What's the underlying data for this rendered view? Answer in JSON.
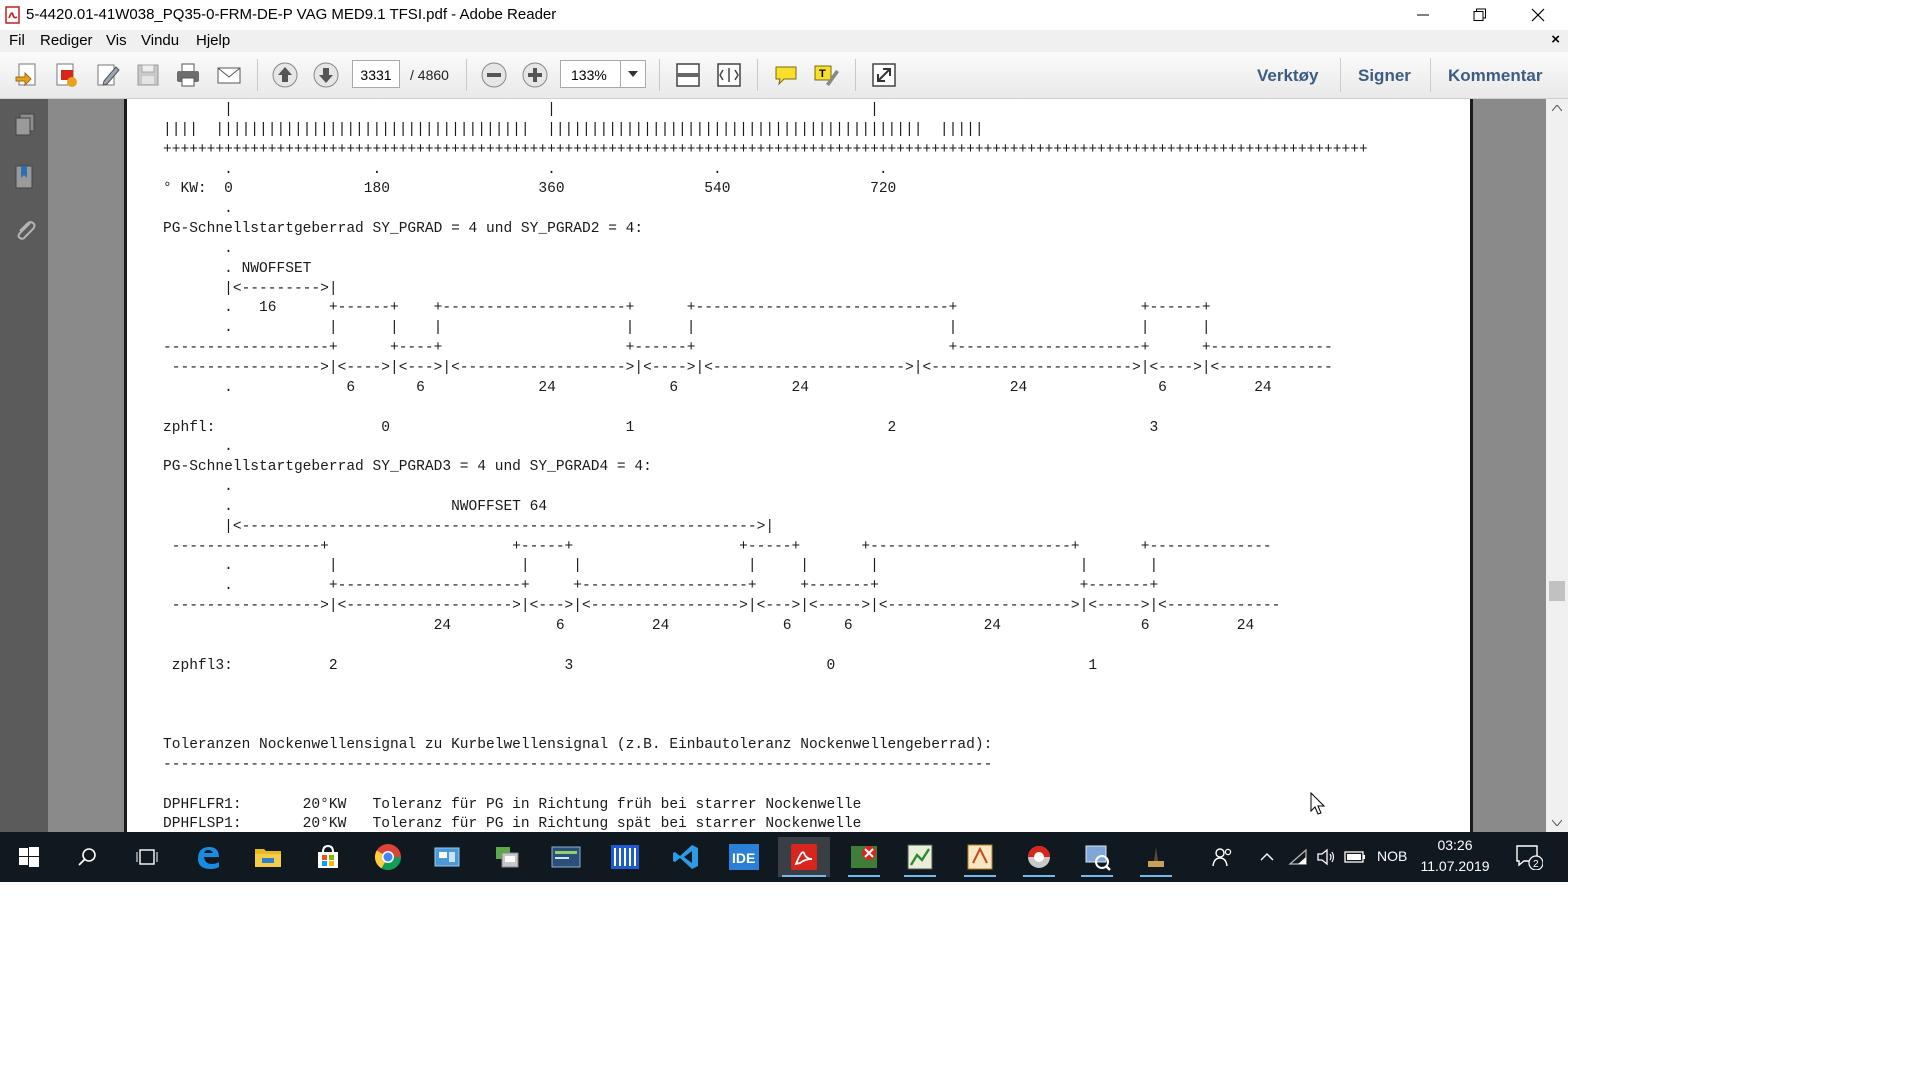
{
  "window": {
    "title": "5-4420.01-41W038_PQ35-0-FRM-DE-P VAG MED9.1 TFSI.pdf - Adobe Reader",
    "doc_close": "×"
  },
  "menu": {
    "file": "Fil",
    "edit": "Rediger",
    "view": "Vis",
    "window": "Vindu",
    "help": "Hjelp"
  },
  "toolbar": {
    "page_current": "3331",
    "page_total": "/ 4860",
    "zoom": "133%",
    "tools_label": "Verktøy",
    "sign_label": "Signer",
    "comment_label": "Kommentar"
  },
  "document": {
    "lines": [
      "       |                                    |                                    |",
      "||||  ||||||||||||||||||||||||||||||||||||  |||||||||||||||||||||||||||||||||||||||||||  |||||",
      "++++++++++++++++++++++++++++++++++++++++++++++++++++++++++++++++++++++++++++++++++++++++++++++++++++++++++++++++++++++++++++++++++++++++++",
      "       .                .                   .                  .                  .",
      "° KW:  0               180                 360                540                720",
      "       .",
      "PG-Schnellstartgeberrad SY_PGRAD = 4 und SY_PGRAD2 = 4:",
      "       .",
      "       . NWOFFSET",
      "       |<--------->|",
      "       .   16      +------+    +---------------------+      +-----------------------------+                     +------+",
      "       .           |      |    |                     |      |                             |                     |      |",
      "-------------------+      +----+                     +------+                             +---------------------+      +--------------",
      " ----------------->|<---->|<--->|<------------------->|<---->|<---------------------->|<----------------------->|<---->|<-------------",
      "       .             6       6             24             6             24                       24               6          24",
      "",
      "zphfl:                   0                           1                             2                             3",
      "       .",
      "PG-Schnellstartgeberrad SY_PGRAD3 = 4 und SY_PGRAD4 = 4:",
      "       .",
      "       .                         NWOFFSET 64",
      "       |<----------------------------------------------------------->|",
      " -----------------+                     +-----+                   +-----+       +-----------------------+       +--------------",
      "       .           |                     |     |                   |     |       |                       |       |",
      "       .           +---------------------+     +-------------------+     +-------+                       +-------+",
      " ----------------->|<------------------->|<--->|<----------------->|<--->|<----->|<--------------------->|<----->|<-------------",
      "                               24            6          24             6      6               24                6          24",
      "",
      " zphfl3:           2                          3                             0                             1",
      "",
      "",
      "",
      "Toleranzen Nockenwellensignal zu Kurbelwellensignal (z.B. Einbautoleranz Nockenwellengeberrad):",
      "-----------------------------------------------------------------------------------------------",
      "",
      "DPHFLFR1:       20°KW   Toleranz für PG in Richtung früh bei starrer Nockenwelle",
      "DPHFLSP1:       20°KW   Toleranz für PG in Richtung spät bei starrer Nockenwelle"
    ]
  },
  "taskbar": {
    "language": "NOB",
    "time": "03:26",
    "date": "11.07.2019",
    "notification_count": "2"
  },
  "colors": {
    "toolbar_accent": "#3e5c83",
    "nav_panel": "#5b5b5b",
    "doc_background": "#8a8a8a",
    "taskbar": "#101820",
    "pdf_red": "#d9261c"
  }
}
